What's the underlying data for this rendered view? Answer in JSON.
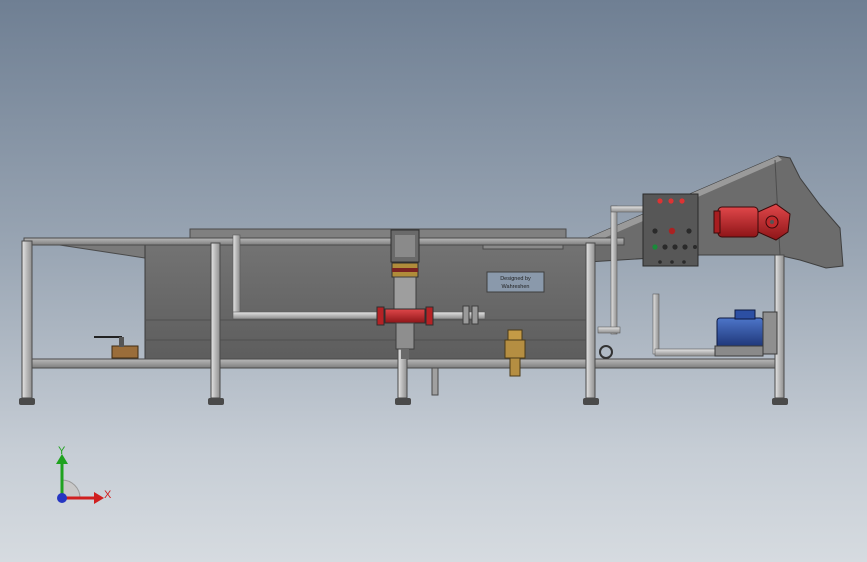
{
  "viewport": {
    "model": {
      "plate_text_line1": "Designed by",
      "plate_text_line2": "Wahreshen"
    },
    "triad": {
      "x_label": "X",
      "y_label": "Y"
    }
  },
  "colors": {
    "frame": "#8c8c8c",
    "tank": "#6b6b6b",
    "motor_red": "#c0252a",
    "motor_blue": "#2c4fa3",
    "panel": "#5a5a5a",
    "axis_x": "#d02020",
    "axis_y": "#20a020",
    "axis_z": "#2030c0"
  }
}
